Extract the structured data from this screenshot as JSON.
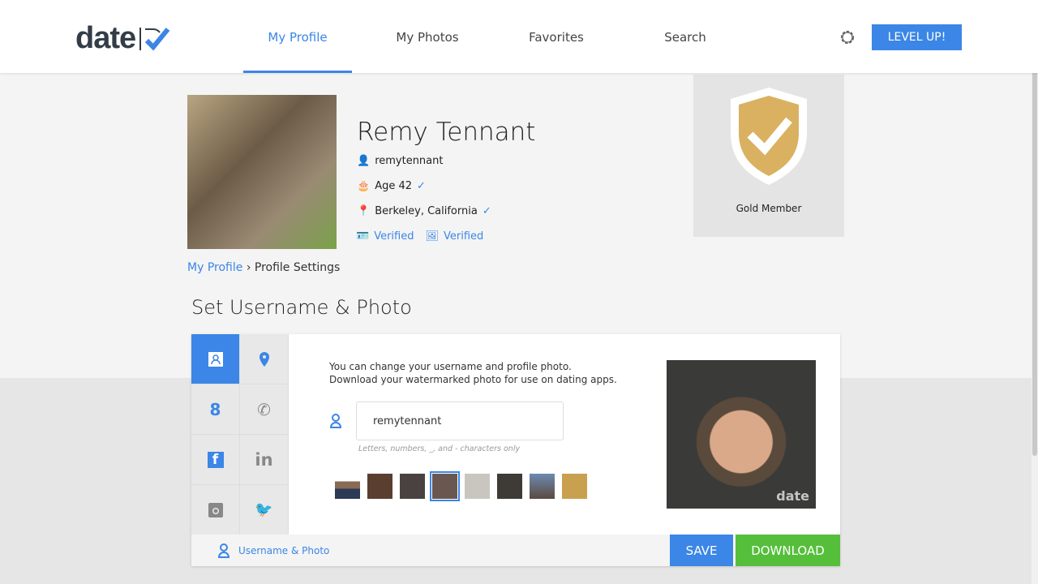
{
  "header": {
    "logo": "date",
    "nav": [
      {
        "label": "My Profile",
        "active": true
      },
      {
        "label": "My Photos"
      },
      {
        "label": "Favorites"
      },
      {
        "label": "Search"
      }
    ],
    "level_up": "LEVEL UP!"
  },
  "profile": {
    "name": "Remy Tennant",
    "username": "remytennant",
    "age": "Age 42",
    "location": "Berkeley, California",
    "verified": [
      "Verified",
      "Verified"
    ],
    "badge": "Gold Member"
  },
  "breadcrumb": {
    "parent": "My Profile",
    "sep": "›",
    "current": "Profile Settings"
  },
  "section_title": "Set Username & Photo",
  "panel": {
    "desc_line1": "You can change your username and profile photo.",
    "desc_line2": "Download your watermarked photo for use on dating apps.",
    "username_value": "remytennant",
    "hint": "Letters, numbers, _, and - characters only",
    "watermark": "date",
    "selected_thumb": 4,
    "footer_label": "Username & Photo",
    "save": "SAVE",
    "download": "DOWNLOAD"
  },
  "colors": {
    "accent": "#3b86e6",
    "download": "#55bf3b",
    "gold": "#d9b160"
  }
}
